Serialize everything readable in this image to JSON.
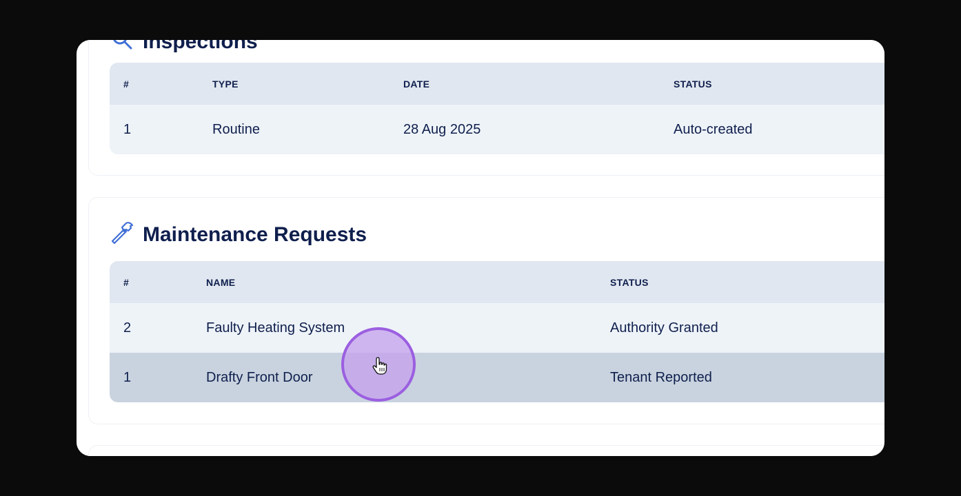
{
  "inspections": {
    "title": "Inspections",
    "columns": [
      "#",
      "TYPE",
      "DATE",
      "STATUS"
    ],
    "rows": [
      {
        "num": "1",
        "type": "Routine",
        "date": "28 Aug 2025",
        "status": "Auto-created"
      }
    ]
  },
  "maintenance": {
    "title": "Maintenance Requests",
    "icon": "hammer-icon",
    "columns": [
      "#",
      "NAME",
      "STATUS"
    ],
    "rows": [
      {
        "num": "2",
        "name": "Faulty Heating System",
        "status": "Authority Granted"
      },
      {
        "num": "1",
        "name": "Drafty Front Door",
        "status": "Tenant Reported"
      }
    ]
  },
  "colors": {
    "title": "#0f1f4d",
    "header_bg": "#e1e7f0",
    "row_bg": "#eef3f8",
    "row_hover_bg": "#c9d3df",
    "icon_blue": "#3f6fd6",
    "cursor_ring": "#9b5fe0"
  }
}
